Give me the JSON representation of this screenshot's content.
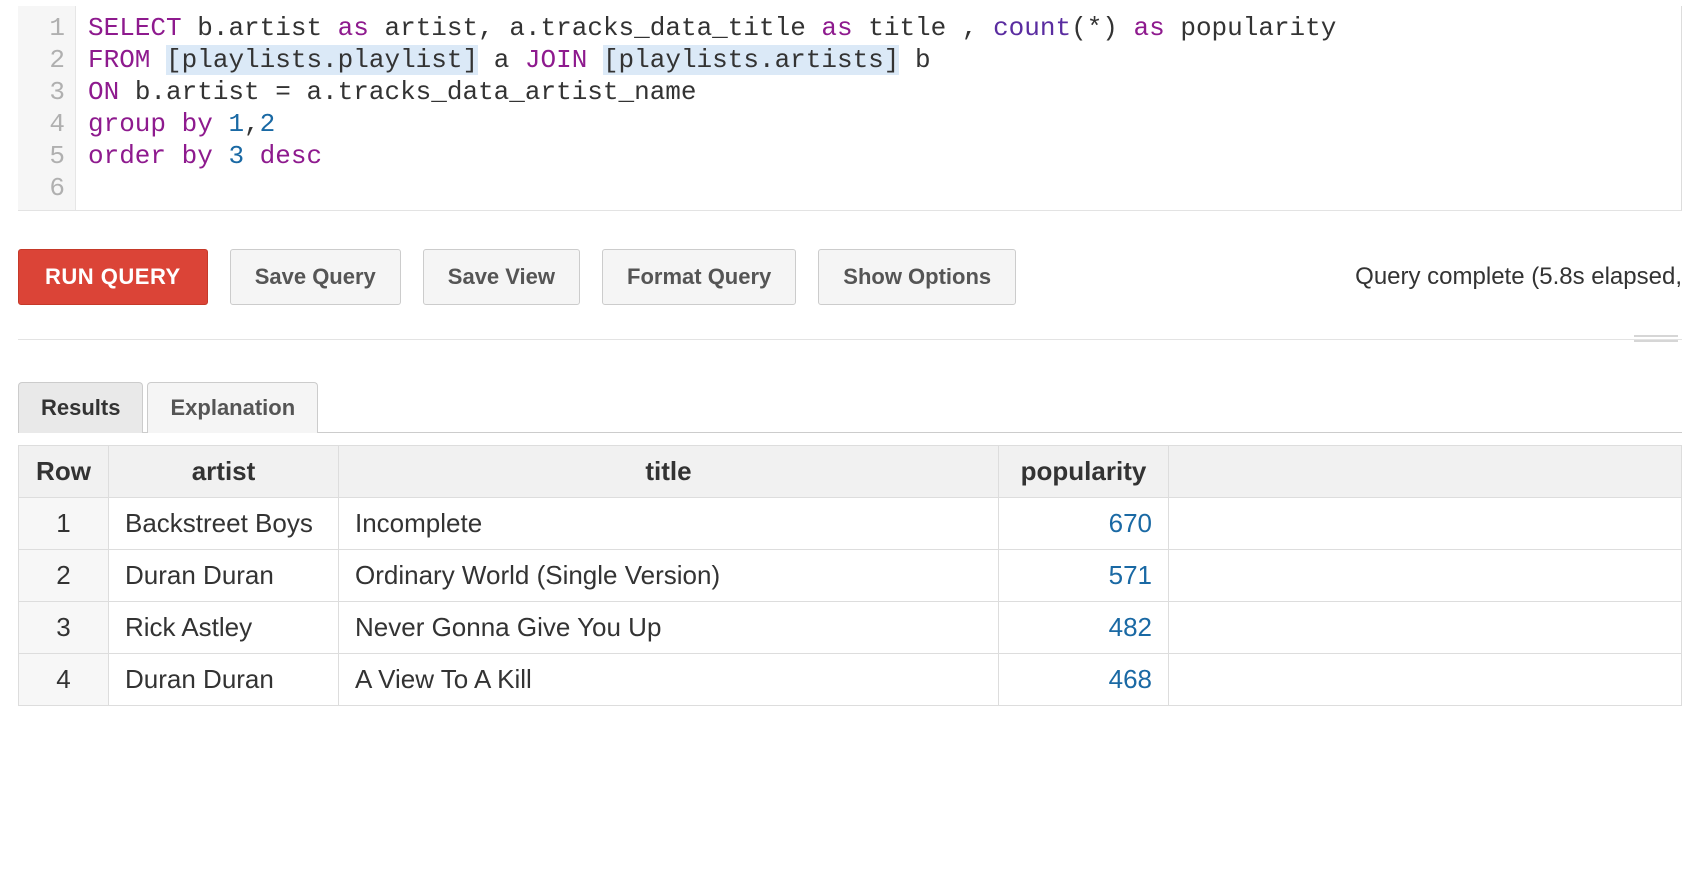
{
  "editor": {
    "line_numbers": [
      "1",
      "2",
      "3",
      "4",
      "5",
      "6"
    ],
    "tokens": [
      [
        {
          "t": "SELECT",
          "c": "kw"
        },
        {
          "t": " "
        },
        {
          "t": "b.artist",
          "c": "id"
        },
        {
          "t": " "
        },
        {
          "t": "as",
          "c": "kw"
        },
        {
          "t": " "
        },
        {
          "t": "artist",
          "c": "id"
        },
        {
          "t": ", "
        },
        {
          "t": "a.tracks_data_title",
          "c": "id"
        },
        {
          "t": " "
        },
        {
          "t": "as",
          "c": "kw"
        },
        {
          "t": " "
        },
        {
          "t": "title",
          "c": "id"
        },
        {
          "t": " , "
        },
        {
          "t": "count",
          "c": "func"
        },
        {
          "t": "("
        },
        {
          "t": "*",
          "c": "star"
        },
        {
          "t": ")"
        },
        {
          "t": " "
        },
        {
          "t": "as",
          "c": "kw"
        },
        {
          "t": " "
        },
        {
          "t": "popularity",
          "c": "id"
        }
      ],
      [
        {
          "t": "FROM",
          "c": "kw"
        },
        {
          "t": " "
        },
        {
          "t": "[playlists.playlist]",
          "c": "tbl"
        },
        {
          "t": " a "
        },
        {
          "t": "JOIN",
          "c": "kw"
        },
        {
          "t": " "
        },
        {
          "t": "[playlists.artists]",
          "c": "tbl"
        },
        {
          "t": " b"
        }
      ],
      [
        {
          "t": "ON",
          "c": "kw"
        },
        {
          "t": " b.artist = a.tracks_data_artist_name"
        }
      ],
      [
        {
          "t": "group by",
          "c": "kw"
        },
        {
          "t": " "
        },
        {
          "t": "1",
          "c": "num"
        },
        {
          "t": ","
        },
        {
          "t": "2",
          "c": "num"
        }
      ],
      [
        {
          "t": "order by",
          "c": "kw"
        },
        {
          "t": " "
        },
        {
          "t": "3",
          "c": "num"
        },
        {
          "t": " "
        },
        {
          "t": "desc",
          "c": "kw"
        }
      ],
      []
    ]
  },
  "toolbar": {
    "run_label": "RUN QUERY",
    "save_query_label": "Save Query",
    "save_view_label": "Save View",
    "format_query_label": "Format Query",
    "show_options_label": "Show Options",
    "status_text": "Query complete (5.8s elapsed, "
  },
  "tabs": {
    "results_label": "Results",
    "explanation_label": "Explanation"
  },
  "results": {
    "columns": [
      "Row",
      "artist",
      "title",
      "popularity"
    ],
    "rows": [
      {
        "row": "1",
        "artist": "Backstreet Boys",
        "title": "Incomplete",
        "popularity": "670"
      },
      {
        "row": "2",
        "artist": "Duran Duran",
        "title": "Ordinary World (Single Version)",
        "popularity": "571"
      },
      {
        "row": "3",
        "artist": "Rick Astley",
        "title": "Never Gonna Give You Up",
        "popularity": "482"
      },
      {
        "row": "4",
        "artist": "Duran Duran",
        "title": "A View To A Kill",
        "popularity": "468"
      }
    ]
  }
}
